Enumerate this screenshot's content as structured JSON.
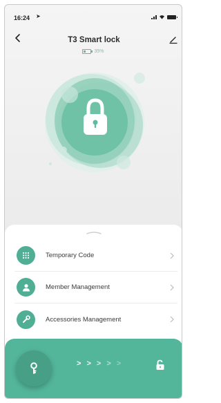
{
  "status_bar": {
    "time": "16:24",
    "location_arrow": "➤",
    "icons": [
      "signal-icon",
      "wifi-icon",
      "battery-icon"
    ]
  },
  "header": {
    "title": "T3 Smart lock",
    "back_icon": "chevron-left-icon",
    "edit_icon": "pencil-icon",
    "battery_text": "35%",
    "battery_level": 0.35
  },
  "lock_visual": {
    "icon": "padlock-icon"
  },
  "menu": {
    "items": [
      {
        "label": "Temporary Code",
        "icon": "keypad-icon"
      },
      {
        "label": "Member Management",
        "icon": "person-icon"
      },
      {
        "label": "Accessories Management",
        "icon": "wrench-icon"
      }
    ]
  },
  "footer": {
    "key_icon": "key-icon",
    "slide_arrows": [
      ">",
      ">",
      ">",
      ">",
      ">"
    ],
    "unlock_icon": "unlocked-padlock-icon"
  },
  "colors": {
    "accent": "#53b69b",
    "accent_dark": "#47a086",
    "background": "#ececec"
  }
}
